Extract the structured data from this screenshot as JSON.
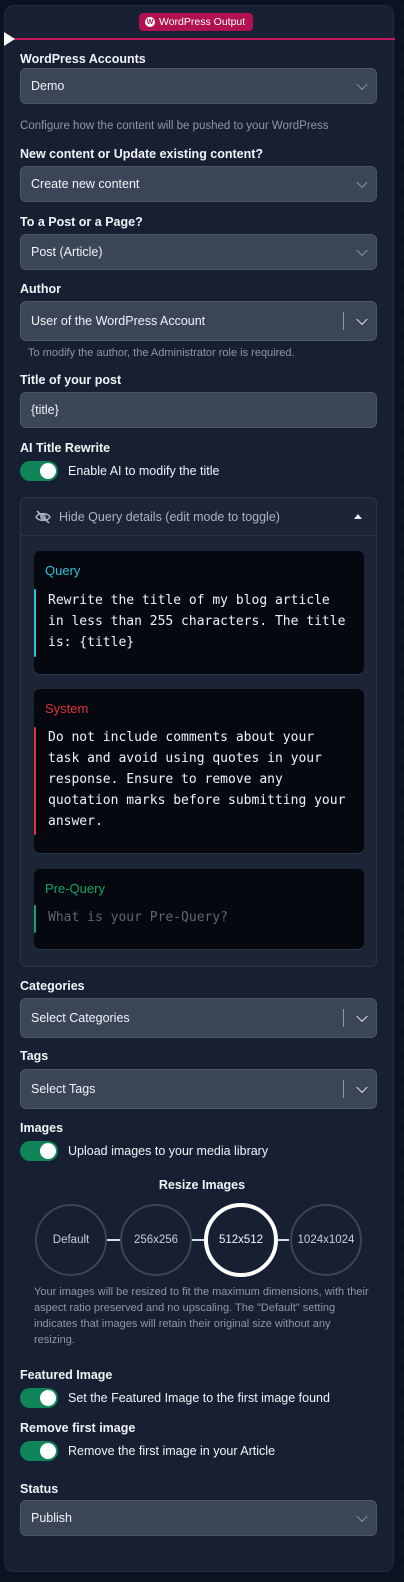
{
  "header": {
    "badge": "WordPress Output"
  },
  "accounts": {
    "label": "WordPress Accounts",
    "value": "Demo"
  },
  "configure_help": "Configure how the content will be pushed to your WordPress",
  "content_mode": {
    "label": "New content or Update existing content?",
    "value": "Create new content"
  },
  "post_type": {
    "label": "To a Post or a Page?",
    "value": "Post (Article)"
  },
  "author": {
    "label": "Author",
    "value": "User of the WordPress Account",
    "help": "To modify the author, the Administrator role is required."
  },
  "title": {
    "label": "Title of your post",
    "value": "{title}"
  },
  "ai_rewrite": {
    "label": "AI Title Rewrite",
    "toggle_label": "Enable AI to modify the title",
    "enabled": true
  },
  "query_panel": {
    "toggle_label": "Hide Query details (edit mode to toggle)",
    "query": {
      "title": "Query",
      "text": "Rewrite the title of my blog article\nin less than 255 characters. The title\nis: {title}",
      "color": "#29c3d9"
    },
    "system": {
      "title": "System",
      "text": "Do not include comments about your\ntask and avoid using quotes in your\nresponse. Ensure to remove any\nquotation marks before submitting your\nanswer.",
      "color": "#e0323c"
    },
    "pre_query": {
      "title": "Pre-Query",
      "placeholder": "What is your Pre-Query?",
      "color": "#12a36b"
    }
  },
  "categories": {
    "label": "Categories",
    "placeholder": "Select Categories"
  },
  "tags": {
    "label": "Tags",
    "placeholder": "Select Tags"
  },
  "images": {
    "label": "Images",
    "toggle_label": "Upload images to your media library",
    "enabled": true
  },
  "resize": {
    "title": "Resize Images",
    "options": [
      "Default",
      "256x256",
      "512x512",
      "1024x1024"
    ],
    "selected": "512x512",
    "help": "Your images will be resized to fit the maximum dimensions, with their aspect ratio preserved and no upscaling. The \"Default\" setting indicates that images will retain their original size without any resizing."
  },
  "featured_image": {
    "label": "Featured Image",
    "toggle_label": "Set the Featured Image to the first image found",
    "enabled": true
  },
  "remove_first_image": {
    "label": "Remove first image",
    "toggle_label": "Remove the first image in your Article",
    "enabled": true
  },
  "status": {
    "label": "Status",
    "value": "Publish"
  },
  "colors": {
    "accent": "#c2185b",
    "toggle_on": "#10855a"
  }
}
